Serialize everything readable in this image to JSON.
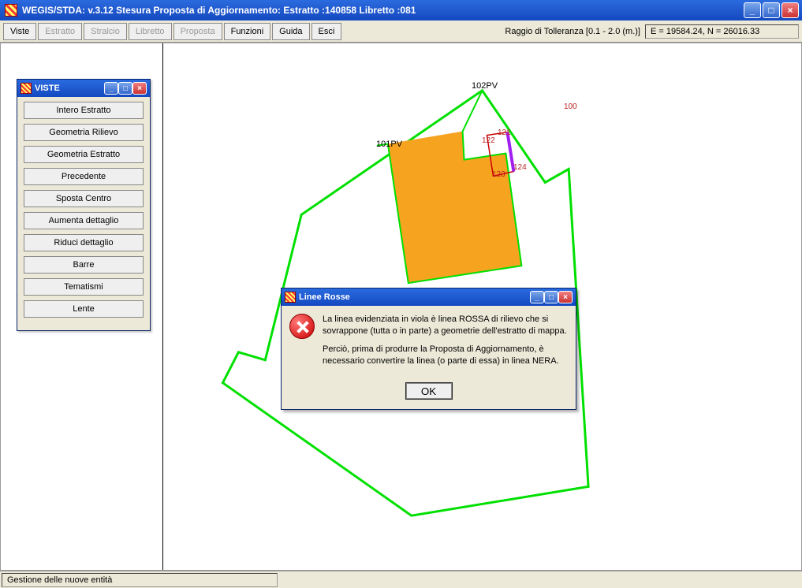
{
  "window": {
    "title": "WEGIS/STDA: v.3.12   Stesura Proposta di Aggiornamento:   Estratto :140858    Libretto  :081"
  },
  "toolbar": {
    "buttons": [
      {
        "label": "Viste",
        "disabled": false
      },
      {
        "label": "Estratto",
        "disabled": true
      },
      {
        "label": "Stralcio",
        "disabled": true
      },
      {
        "label": "Libretto",
        "disabled": true
      },
      {
        "label": "Proposta",
        "disabled": true
      },
      {
        "label": "Funzioni",
        "disabled": false
      },
      {
        "label": "Guida",
        "disabled": false
      },
      {
        "label": "Esci",
        "disabled": false
      }
    ],
    "tolerance_label": "Raggio di Tolleranza [0.1 - 2.0 (m.)]",
    "coords": "E =  19584.24,  N =  26016.33"
  },
  "viste": {
    "title": "VISTE",
    "buttons": [
      "Intero Estratto",
      "Geometria Rilievo",
      "Geometria Estratto",
      "Precedente",
      "Sposta Centro",
      "Aumenta dettaglio",
      "Riduci dettaglio",
      "Barre",
      "Tematismi",
      "Lente"
    ]
  },
  "map": {
    "labels": {
      "pv101": "101PV",
      "pv102": "102PV",
      "p100": "100",
      "p121": "121",
      "p122": "122",
      "p123": "123",
      "p124": "124"
    }
  },
  "modal": {
    "title": "Linee Rosse",
    "p1": "La linea evidenziata in viola è linea ROSSA di rilievo che si sovrappone (tutta o in parte) a geometrie dell'estratto di mappa.",
    "p2": "Perciò, prima di produrre la Proposta di Aggiornamento, è necessario convertire la linea (o parte di essa) in linea NERA.",
    "ok": "OK"
  },
  "statusbar": {
    "text": "Gestione delle nuove entità"
  }
}
